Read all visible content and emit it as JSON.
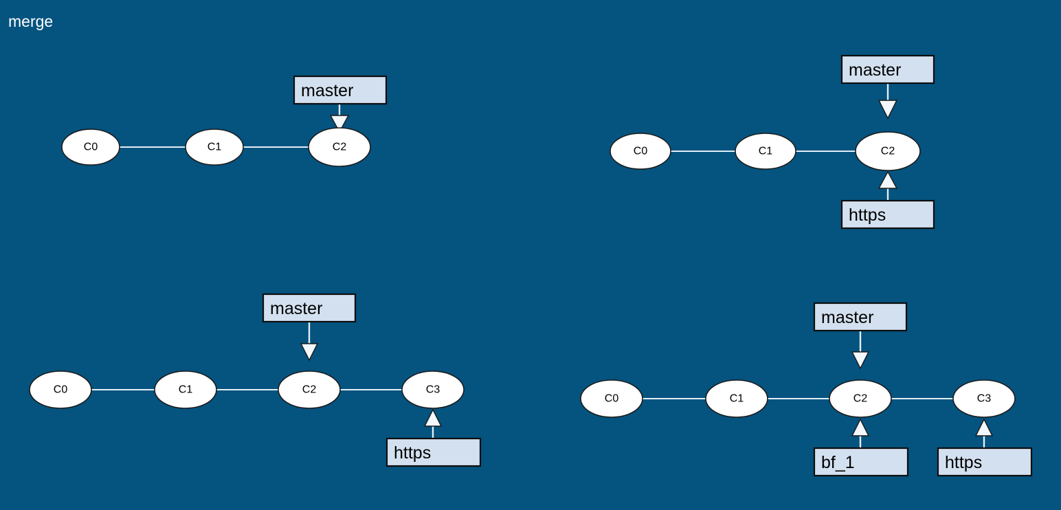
{
  "title": "merge",
  "colors": {
    "background": "#05537f",
    "title_text": "#ffffff",
    "node_fill": "#ffffff",
    "node_stroke": "#1b1b1b",
    "edge": "#e4f0f7",
    "ref_box_fill": "#d3e0ef",
    "ref_box_stroke": "#0d0d0d",
    "ref_text": "#000000",
    "arrowhead_fill": "#f2f8fc"
  },
  "diagrams": [
    {
      "id": "diagram-top-left",
      "name": "commit-graph-top-left",
      "commits": [
        {
          "label": "C0"
        },
        {
          "label": "C1"
        },
        {
          "label": "C2"
        }
      ],
      "edges": [
        {
          "from": "C0",
          "to": "C1"
        },
        {
          "from": "C1",
          "to": "C2"
        }
      ],
      "refs": [
        {
          "label": "master",
          "target": "C2",
          "direction": "down"
        }
      ]
    },
    {
      "id": "diagram-top-right",
      "name": "commit-graph-top-right",
      "commits": [
        {
          "label": "C0"
        },
        {
          "label": "C1"
        },
        {
          "label": "C2"
        }
      ],
      "edges": [
        {
          "from": "C0",
          "to": "C1"
        },
        {
          "from": "C1",
          "to": "C2"
        }
      ],
      "refs": [
        {
          "label": "master",
          "target": "C2",
          "direction": "down"
        },
        {
          "label": "https",
          "target": "C2",
          "direction": "up"
        }
      ]
    },
    {
      "id": "diagram-bottom-left",
      "name": "commit-graph-bottom-left",
      "commits": [
        {
          "label": "C0"
        },
        {
          "label": "C1"
        },
        {
          "label": "C2"
        },
        {
          "label": "C3"
        }
      ],
      "edges": [
        {
          "from": "C0",
          "to": "C1"
        },
        {
          "from": "C1",
          "to": "C2"
        },
        {
          "from": "C2",
          "to": "C3"
        }
      ],
      "refs": [
        {
          "label": "master",
          "target": "C2",
          "direction": "down"
        },
        {
          "label": "https",
          "target": "C3",
          "direction": "up"
        }
      ]
    },
    {
      "id": "diagram-bottom-right",
      "name": "commit-graph-bottom-right",
      "commits": [
        {
          "label": "C0"
        },
        {
          "label": "C1"
        },
        {
          "label": "C2"
        },
        {
          "label": "C3"
        }
      ],
      "edges": [
        {
          "from": "C0",
          "to": "C1"
        },
        {
          "from": "C1",
          "to": "C2"
        },
        {
          "from": "C2",
          "to": "C3"
        }
      ],
      "refs": [
        {
          "label": "master",
          "target": "C2",
          "direction": "down"
        },
        {
          "label": "bf_1",
          "target": "C2",
          "direction": "up"
        },
        {
          "label": "https",
          "target": "C3",
          "direction": "up"
        }
      ]
    }
  ]
}
